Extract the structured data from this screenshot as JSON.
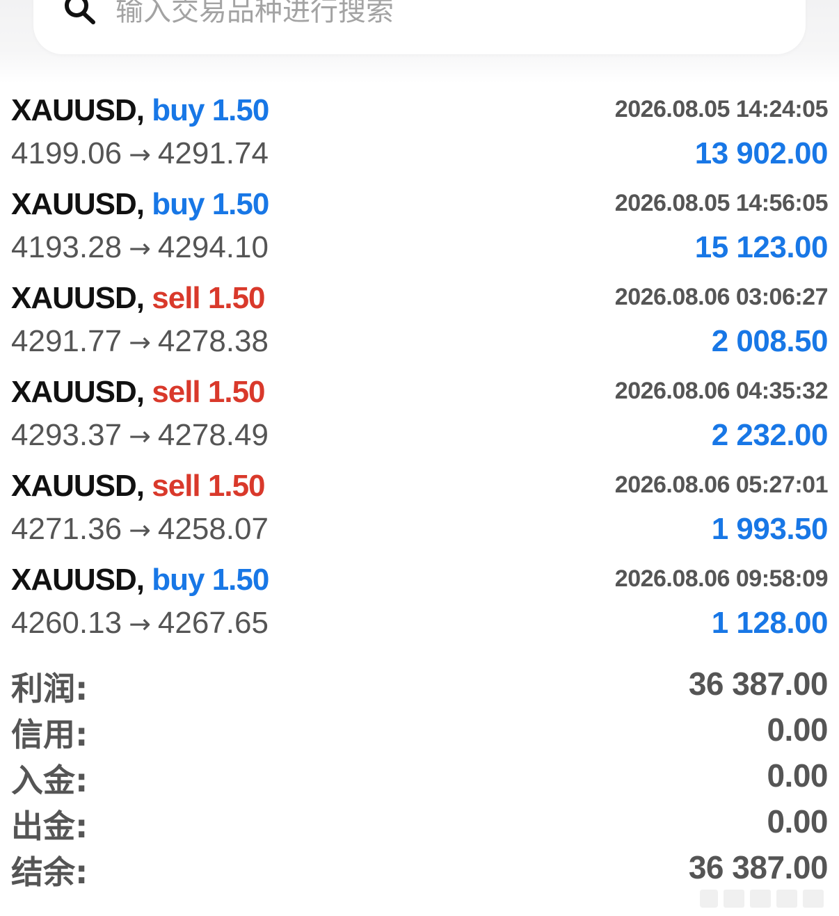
{
  "search": {
    "placeholder": "输入交易品种进行搜索"
  },
  "trades": [
    {
      "symbol": "XAUUSD,",
      "direction": "buy",
      "direction_label": "buy 1.50",
      "time": "2026.08.05 14:24:05",
      "open_price": "4199.06",
      "close_price": "4291.74",
      "arrow": "→",
      "profit": "13 902.00"
    },
    {
      "symbol": "XAUUSD,",
      "direction": "buy",
      "direction_label": "buy 1.50",
      "time": "2026.08.05 14:56:05",
      "open_price": "4193.28",
      "close_price": "4294.10",
      "arrow": "→",
      "profit": "15 123.00"
    },
    {
      "symbol": "XAUUSD,",
      "direction": "sell",
      "direction_label": "sell 1.50",
      "time": "2026.08.06 03:06:27",
      "open_price": "4291.77",
      "close_price": "4278.38",
      "arrow": "→",
      "profit": "2 008.50"
    },
    {
      "symbol": "XAUUSD,",
      "direction": "sell",
      "direction_label": "sell 1.50",
      "time": "2026.08.06 04:35:32",
      "open_price": "4293.37",
      "close_price": "4278.49",
      "arrow": "→",
      "profit": "2 232.00"
    },
    {
      "symbol": "XAUUSD,",
      "direction": "sell",
      "direction_label": "sell 1.50",
      "time": "2026.08.06 05:27:01",
      "open_price": "4271.36",
      "close_price": "4258.07",
      "arrow": "→",
      "profit": "1 993.50"
    },
    {
      "symbol": "XAUUSD,",
      "direction": "buy",
      "direction_label": "buy 1.50",
      "time": "2026.08.06 09:58:09",
      "open_price": "4260.13",
      "close_price": "4267.65",
      "arrow": "→",
      "profit": "1 128.00"
    }
  ],
  "summary": [
    {
      "label": "利润:",
      "value": "36 387.00"
    },
    {
      "label": "信用:",
      "value": "0.00"
    },
    {
      "label": "入金:",
      "value": "0.00"
    },
    {
      "label": "出金:",
      "value": "0.00"
    },
    {
      "label": "结余:",
      "value": "36 387.00"
    }
  ],
  "colors": {
    "buy": "#1877e6",
    "sell": "#d9392b",
    "profit": "#1877e6",
    "muted_text": "#555555"
  },
  "icons": {
    "search": "search-icon"
  }
}
